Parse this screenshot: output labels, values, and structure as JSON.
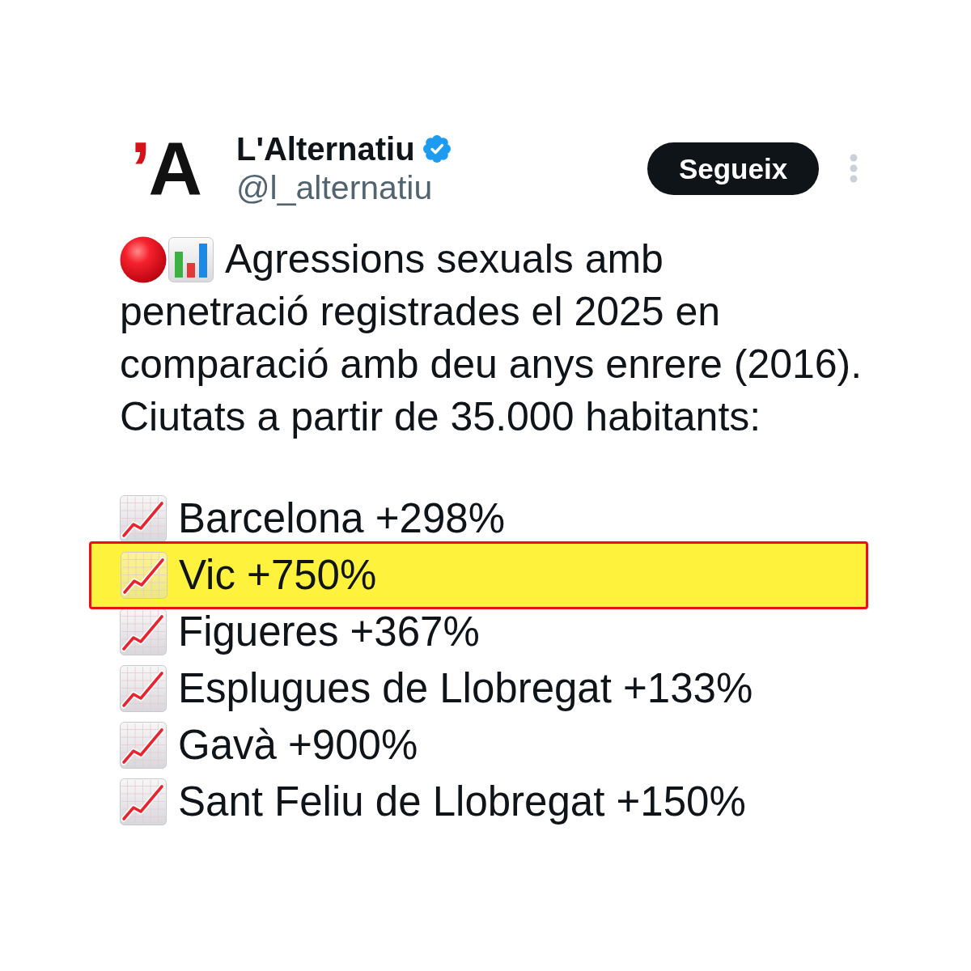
{
  "account": {
    "logo": {
      "accent": "’",
      "letter": "A"
    },
    "name": "L'Alternatiu",
    "verified": true,
    "handle": "@l_alternatiu"
  },
  "follow_button": {
    "label": "Segueix"
  },
  "post": {
    "text_lines": [
      "Agressions sexuals amb",
      "penetració registrades el 2025 en",
      "comparació amb deu anys enrere (2016).",
      "Ciutats a partir de 35.000 habitants:"
    ],
    "items": [
      {
        "text": "Barcelona +298%",
        "highlighted": false
      },
      {
        "text": "Vic +750%",
        "highlighted": true
      },
      {
        "text": "Figueres +367%",
        "highlighted": false
      },
      {
        "text": "Esplugues de Llobregat +133%",
        "highlighted": false
      },
      {
        "text": "Gavà +900%",
        "highlighted": false
      },
      {
        "text": "Sant Feliu de Llobregat +150%",
        "highlighted": false
      }
    ]
  }
}
